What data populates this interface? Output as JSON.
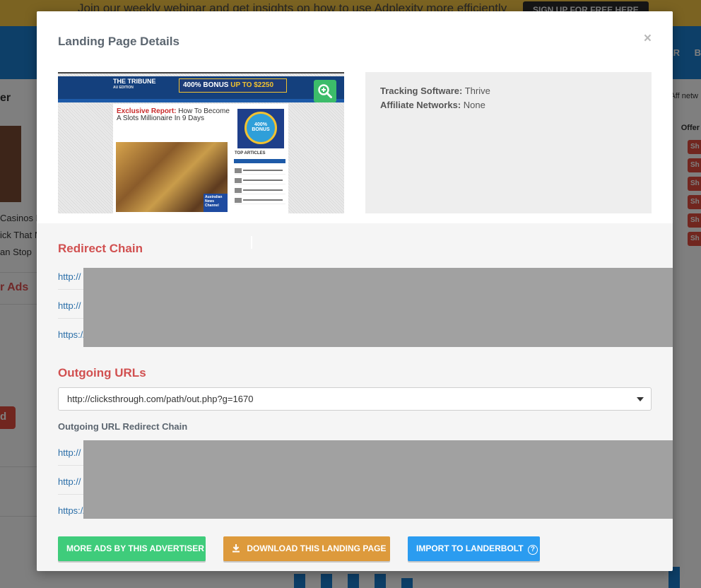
{
  "background": {
    "banner_text": "Join our weekly webinar and get insights on how to use Adplexity more efficiently",
    "banner_button": "SIGN UP FOR FREE HERE",
    "header_right_1": "ER",
    "header_right_2": "B",
    "left_title": "er",
    "left_snippet_1": "Casinos F",
    "left_snippet_2": "ick That N",
    "left_snippet_3": "an Stop",
    "left_ads": "r Ads",
    "left_button": "d",
    "right_aff": "Aff netw",
    "right_offer": "Offer",
    "right_tag": "Sh"
  },
  "modal": {
    "title": "Landing Page Details",
    "close": "×",
    "thumbnail": {
      "logo": "THE TRIBUNE",
      "logo_sub": "AU EDITION",
      "ad_text": "400% BONUS",
      "ad_highlight": "UP TO $2250",
      "headline_red": "Exclusive Report:",
      "headline": "How To Become A Slots Millionaire In 9 Days",
      "coin_text": "400% BONUS",
      "side_title": "TOP ARTICLES",
      "photo_badge": "Australian News Channel"
    },
    "tracking": {
      "software_label": "Tracking Software:",
      "software_value": "Thrive",
      "networks_label": "Affiliate Networks:",
      "networks_value": "None"
    },
    "redirect_chain": {
      "title": "Redirect Chain",
      "links": [
        "http://",
        "http://",
        "https://"
      ]
    },
    "outgoing": {
      "title": "Outgoing URLs",
      "selected": "http://clicksthrough.com/path/out.php?g=1670",
      "chain_title": "Outgoing URL Redirect Chain",
      "links": [
        "http://",
        "http://",
        "https://"
      ]
    },
    "buttons": {
      "more_ads": "More ads by this advertiser",
      "download": "Download this landing page",
      "import": "Import to Landerbolt",
      "help": "?"
    }
  },
  "colors": {
    "section_title": "#d15050",
    "link": "#2a6ea8",
    "green": "#3fcc7b",
    "orange": "#dd9a3c",
    "blue": "#2b9cf0",
    "redact": "#a1a1a1"
  },
  "icons": {
    "zoom": "zoom-in-icon",
    "download": "download-icon",
    "help": "help-circle-icon",
    "dropdown": "chevron-down-icon",
    "close": "close-icon"
  }
}
